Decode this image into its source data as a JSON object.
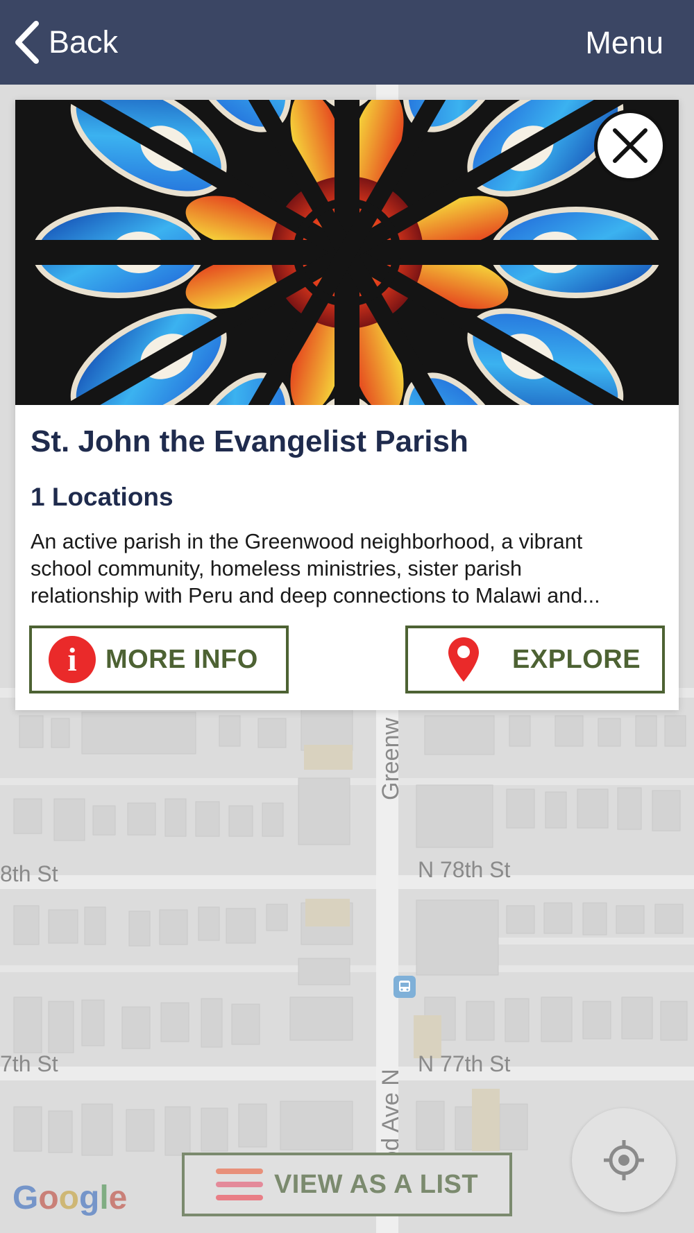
{
  "nav": {
    "back_label": "Back",
    "menu_label": "Menu",
    "background_color": "#3b4664"
  },
  "card": {
    "title": "St. John the Evangelist Parish",
    "locations": "1 Locations",
    "description_lines": [
      "An active parish in the Greenwood neighborhood, a vibrant",
      "school community, homeless ministries, sister parish",
      "relationship with Peru and deep connections to Malawi and..."
    ],
    "more_info_label": "MORE INFO",
    "explore_label": "EXPLORE",
    "accent_color": "#4d6233",
    "title_color": "#1f2b4d",
    "hero_image": "stained-glass-rose-window"
  },
  "map": {
    "streets": {
      "n78": "N 78th St",
      "n78_left": "8th St",
      "n77": "N 77th St",
      "n77_left": "7th St",
      "greenwood_upper": "Greenw",
      "greenwood_lower": "wood Ave N"
    },
    "google_logo": "Google",
    "list_button_label": "VIEW AS A LIST"
  }
}
